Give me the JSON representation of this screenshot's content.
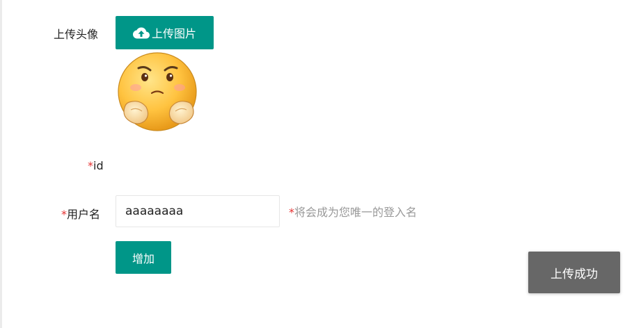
{
  "form": {
    "avatar_label": "上传头像",
    "upload_button": "上传图片",
    "id_required_mark": "*",
    "id_label": "id",
    "username_required_mark": "*",
    "username_label": "用户名",
    "username_value": "aaaaaaaa",
    "username_hint_mark": "*",
    "username_hint": "将会成为您唯一的登入名",
    "add_button": "增加"
  },
  "toast": {
    "message": "上传成功"
  },
  "icons": {
    "upload": "cloud-upload-icon",
    "avatar": "emoji-avatar-image"
  },
  "colors": {
    "primary": "#009688",
    "required": "#e63232",
    "hint": "#999999",
    "toast_bg": "#676767"
  }
}
